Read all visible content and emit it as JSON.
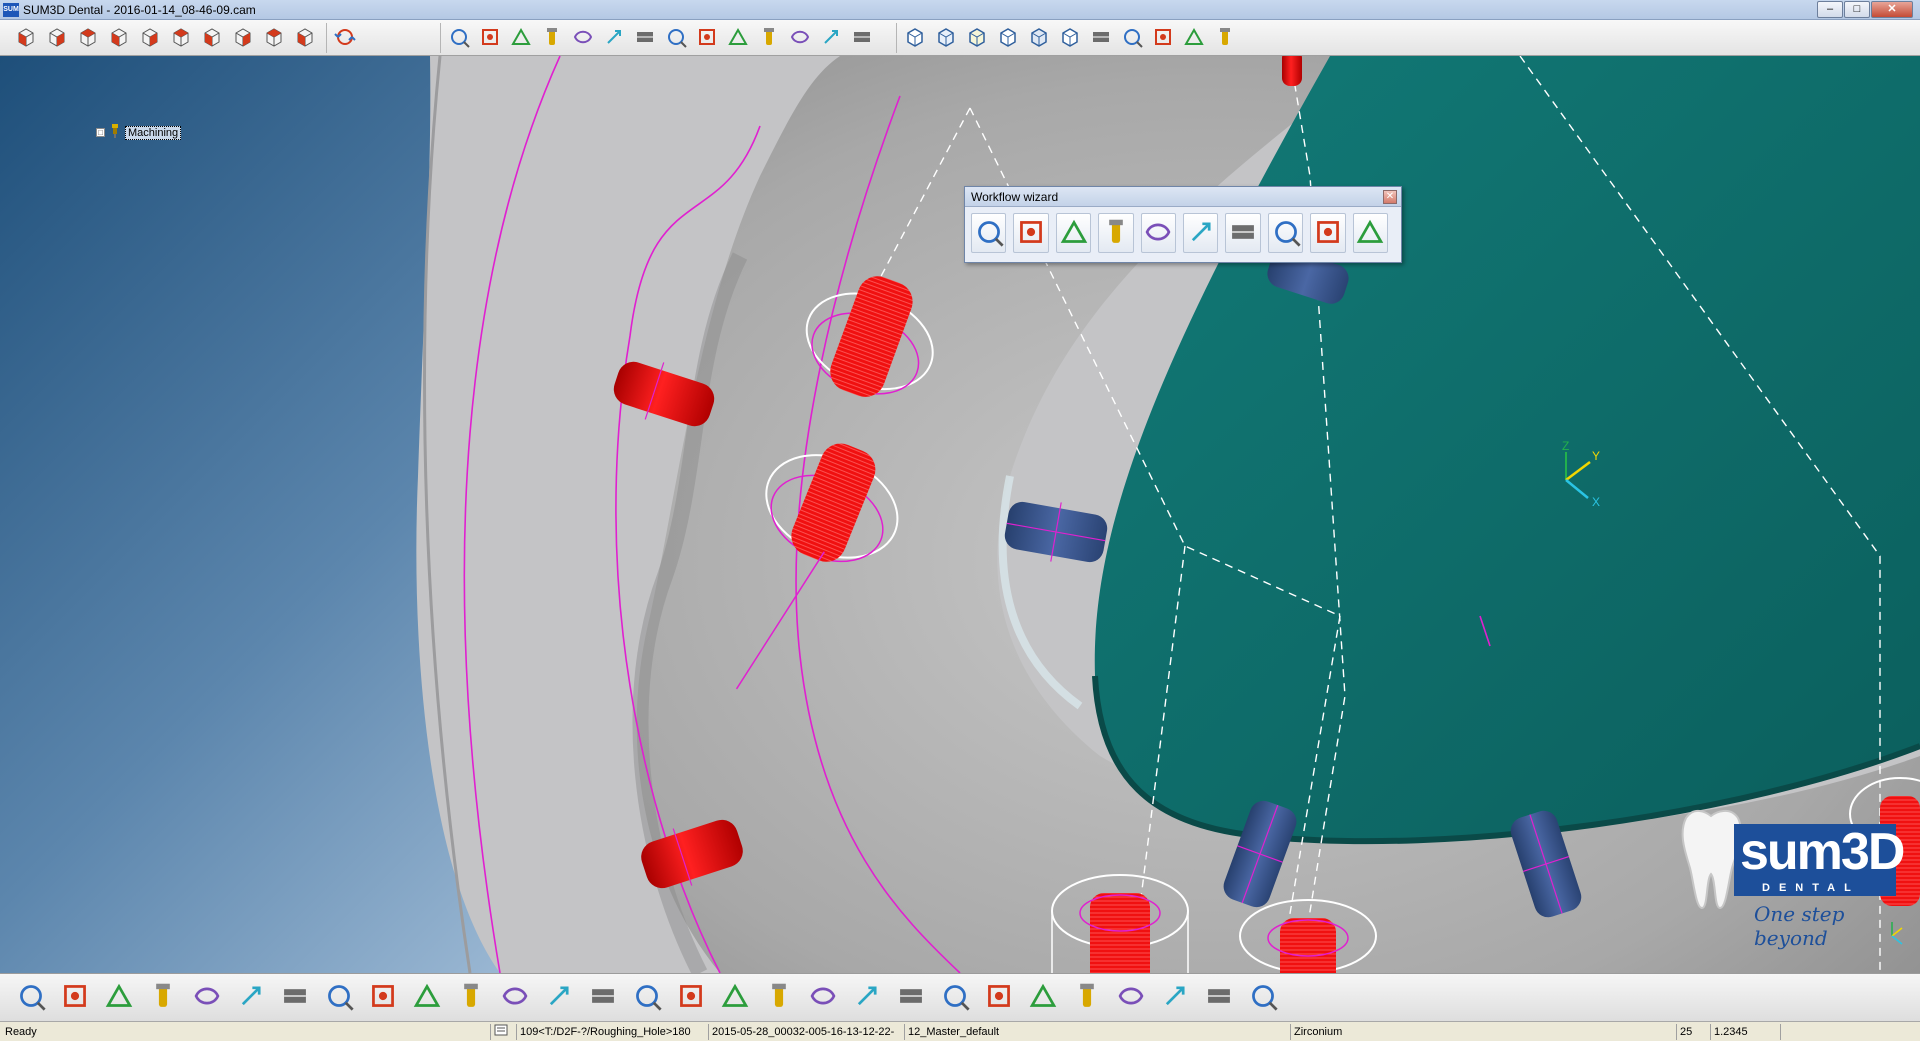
{
  "window": {
    "title": "SUM3D Dental  -  2016-01-14_08-46-09.cam",
    "app_icon_text": "SUM",
    "controls": {
      "minimize": "–",
      "maximize": "□",
      "close": "✕"
    }
  },
  "toolbar_top": {
    "view_cubes": [
      "view-front",
      "view-back",
      "view-left",
      "view-right",
      "view-top",
      "view-bottom",
      "view-iso-1",
      "view-iso-2",
      "view-iso-3",
      "view-iso-4"
    ],
    "rotate": "rotate-view",
    "zoom_tools": [
      "zoom-in",
      "zoom-out",
      "zoom-undo",
      "zoom-window",
      "zoom-fit",
      "pan",
      "dimension-1",
      "dimension-2",
      "dimension-3",
      "move-part",
      "move-axis",
      "tool-1",
      "tool-2",
      "toggle-pointer"
    ],
    "render_modes": [
      "wire-cube",
      "hidden-cube",
      "shaded-cube",
      "solid-cube",
      "mesh-cube",
      "flat-cube",
      "curve-view",
      "toolpath-view",
      "stock-view",
      "simulation-view",
      "stock-grey"
    ]
  },
  "tree": {
    "expander": "□",
    "items": [
      {
        "label": "Machining",
        "icon": "tool-holder-icon"
      }
    ]
  },
  "workflow_wizard": {
    "title": "Workflow wizard",
    "close": "✕",
    "buttons": [
      "new-project",
      "import-part",
      "load-template",
      "import-stock",
      "place-parts",
      "calculate",
      "rotate-parts",
      "edit-part",
      "delete-parts",
      "post-process"
    ]
  },
  "axis_triad": {
    "z": "Z",
    "y": "Y",
    "x": "X"
  },
  "logo": {
    "brand": "sum3D",
    "sub": "DENTAL",
    "tagline": "One step beyond"
  },
  "toolbar_bottom": [
    "open-file",
    "position",
    "stock-setup",
    "holder",
    "cut-mesh",
    "connector",
    "angle",
    "move-connector",
    "cylinder",
    "cylinder-2",
    "spray",
    "tooth-toolpath",
    "drill",
    "post",
    "multi-tool",
    "screw-channel",
    "rotate-mesh",
    "analyze",
    "swap",
    "refresh",
    "compare",
    "tooth-analyze",
    "settings",
    "pen-tool",
    "export",
    "sync",
    "browser",
    "timer",
    "report"
  ],
  "status": {
    "ready": "Ready",
    "path": "109<T:/D2F-?/Roughing_Hole>180",
    "file": "2015-05-28_00032-005-16-13-12-22-",
    "template": "12_Master_default",
    "material": "Zirconium",
    "count": "25",
    "value": "1.2345"
  },
  "colors": {
    "viewport_top": "#1e4f7a",
    "plate": "#0e6c6a",
    "model": "#b9b9b9",
    "implant": "#f20e0e",
    "connector_blue": "#3f5b96",
    "toolpath": "#e020d0"
  }
}
